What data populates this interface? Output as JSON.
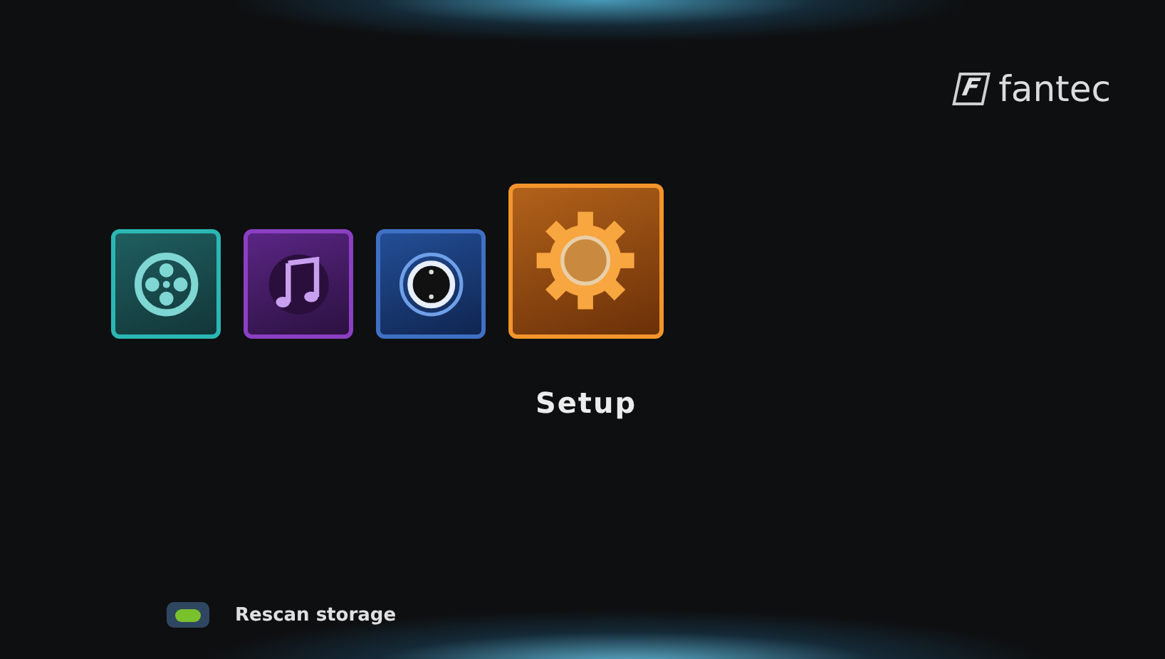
{
  "logo": {
    "mark": "F",
    "name": "fantec"
  },
  "menu": [
    {
      "kind": "movie",
      "selected": false
    },
    {
      "kind": "music",
      "selected": false
    },
    {
      "kind": "photo",
      "selected": false
    },
    {
      "kind": "setup",
      "selected": true
    }
  ],
  "focused_label": "Setup",
  "hint": {
    "label": "Rescan storage"
  }
}
